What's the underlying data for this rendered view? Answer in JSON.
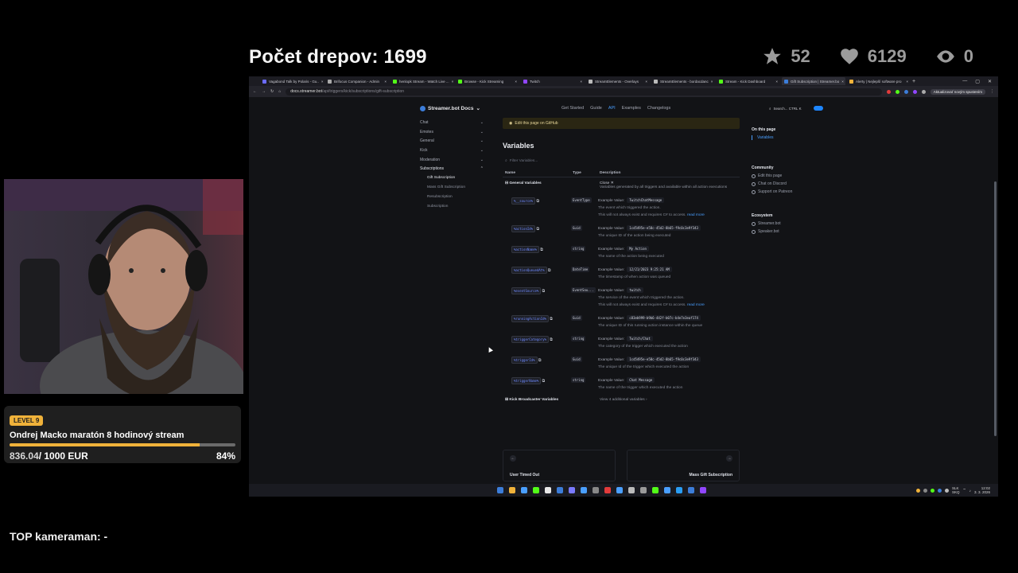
{
  "overlay": {
    "title": "Počet drepov: 1699",
    "stats": {
      "stars": "52",
      "hearts": "6129",
      "viewers": "0"
    },
    "goal": {
      "level": "LEVEL 9",
      "name": "Ondrej Macko maratón 8 hodinový stream",
      "current": "836.04",
      "target": "/ 1000 EUR",
      "percent": "84%",
      "progress": 0.84
    },
    "top_cameraman": "TOP kameraman: -"
  },
  "browser": {
    "tabs": [
      {
        "label": "Vagabond Talk by Polaris - Gu..",
        "color": "#6b6bff"
      },
      {
        "label": "Brifocus Companion - Admin",
        "color": "#aaa"
      },
      {
        "label": "henlopk Stream - Watch Live ...",
        "color": "#53fc18"
      },
      {
        "label": "Browse - Kick Streaming",
        "color": "#53fc18"
      },
      {
        "label": "Twitch",
        "color": "#9146ff"
      },
      {
        "label": "StreamElements - Overlays",
        "color": "#bbb"
      },
      {
        "label": "StreamElements - bordacdanc",
        "color": "#bbb"
      },
      {
        "label": "Stream - Kick Dashboard",
        "color": "#53fc18"
      },
      {
        "label": "Gift Subscription | Streamer.bo",
        "color": "#3c7dd9",
        "active": true
      },
      {
        "label": "Alerty | Nejlepší software pro",
        "color": "#f0b23a"
      }
    ],
    "url_host": "docs.streamer.bot",
    "url_path": "/api/triggers/kick/subscriptions/gift-subscription",
    "update_button": "Aktualizovať novým spustením"
  },
  "docs": {
    "logo": "Streamer.bot Docs",
    "topnav": [
      "Get Started",
      "Guide",
      "API",
      "Examples",
      "Changelogs"
    ],
    "search": "Search...  CTRL  K",
    "sidebar": [
      {
        "label": "Chat"
      },
      {
        "label": "Emotes"
      },
      {
        "label": "General"
      },
      {
        "label": "Kick"
      },
      {
        "label": "Moderation"
      },
      {
        "label": "Subscriptions",
        "open": true
      }
    ],
    "sidebar_sub": [
      "Gift Subscription",
      "Mass Gift Subscription",
      "Resubscription",
      "Subscription"
    ],
    "github_banner": "Edit this page on GitHub",
    "variables_heading": "Variables",
    "filter_placeholder": "Filter Variables...",
    "columns": [
      "Name",
      "Type",
      "Description"
    ],
    "general_group": {
      "title": "General Variables",
      "close": "Close",
      "desc": "Variables generated by all triggers and available within all action executions"
    },
    "rows": [
      {
        "name": "%__source%",
        "type": "EventType",
        "value": "TwitchChatMessage",
        "desc": "The event which triggered the action.",
        "note": "This will not always exist and requires C# to access.",
        "more": "read more"
      },
      {
        "name": "%actionId%",
        "type": "Guid",
        "value": "1cd5495e-e58c-45d2-8b65-f9c0c3e9f343",
        "desc": "The unique ID of the action being executed"
      },
      {
        "name": "%actionName%",
        "type": "string",
        "value": "My Action",
        "desc": "The name of the action being executed"
      },
      {
        "name": "%actionQueuedAt%",
        "type": "DateTime",
        "value": "12/21/2023 9:25:21 AM",
        "desc": "The timestamp of when action was queued"
      },
      {
        "name": "%eventSource%",
        "type": "EventSou...",
        "value": "twitch",
        "desc": "The service of the event which triggered the action.",
        "note": "This will not always exist and requires C# to access.",
        "more": "read more"
      },
      {
        "name": "%runningActionId%",
        "type": "Guid",
        "value": "c83eb999-b9b6-442f-b07c-b4e7e3eaf174",
        "desc": "The unique ID of this running action instance within the queue"
      },
      {
        "name": "%triggerCategory%",
        "type": "string",
        "value": "Twitch/Chat",
        "desc": "The category of the trigger which executed the action"
      },
      {
        "name": "%triggerId%",
        "type": "Guid",
        "value": "1cd5495e-e58c-45d2-8b65-f9c0c3e9f343",
        "desc": "The unique Id of the trigger which executed the action"
      },
      {
        "name": "%triggerName%",
        "type": "string",
        "value": "Chat Message",
        "desc": "The name of the trigger which executed the action"
      }
    ],
    "example_label": "Example Value:",
    "kick_group": {
      "title": "Kick Broadcaster Variables",
      "view": "View 4 additional variables"
    },
    "pager": {
      "prev": "User Timed Out",
      "next": "Mass Gift Subscription"
    },
    "toc": {
      "on_this_page": "On this page",
      "variables_link": "Variables",
      "community": "Community",
      "community_links": [
        "Edit this page",
        "Chat on Discord",
        "Support on Patreon"
      ],
      "ecosystem": "Ecosystem",
      "ecosystem_links": [
        "Streamer.bot",
        "Speaker.bot"
      ]
    }
  },
  "taskbar": {
    "lang": "SLK",
    "lang2": "SKQ",
    "time": "12:02",
    "date": "3. 3. 2026"
  }
}
